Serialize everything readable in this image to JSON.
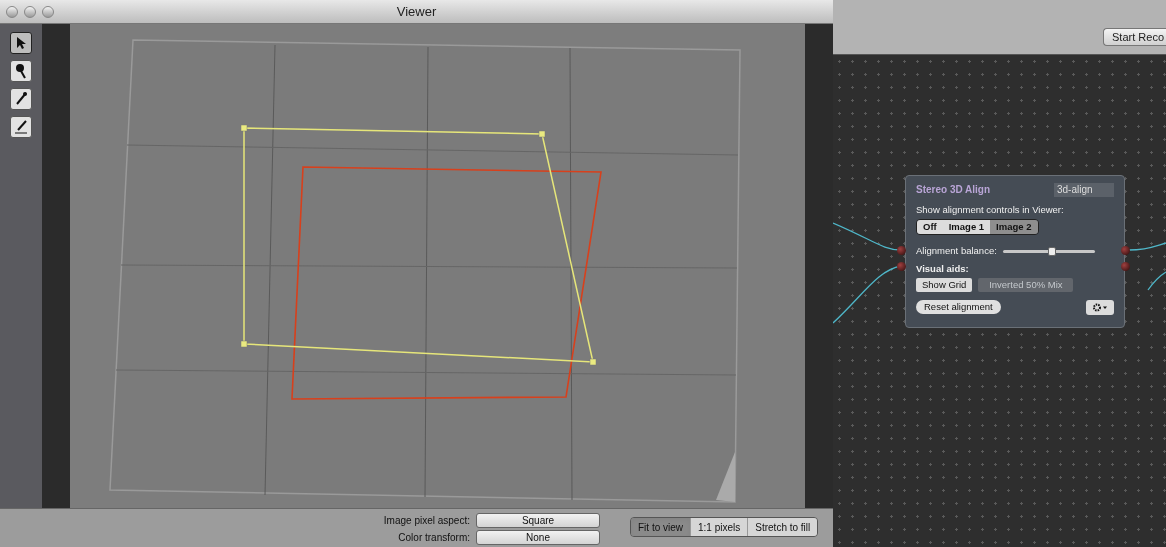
{
  "viewer": {
    "title": "Viewer",
    "tools": [
      {
        "kind": "arrow",
        "selected": true
      },
      {
        "kind": "pin",
        "selected": false
      },
      {
        "kind": "dropper",
        "selected": false
      },
      {
        "kind": "dropper-line",
        "selected": false
      }
    ]
  },
  "bottom_bar": {
    "fields": [
      {
        "label": "Image pixel aspect:",
        "value": "Square"
      },
      {
        "label": "Color transform:",
        "value": "None"
      }
    ],
    "fit_modes": [
      {
        "label": "Fit to view",
        "selected": true
      },
      {
        "label": "1:1 pixels",
        "selected": false
      },
      {
        "label": "Stretch to fill",
        "selected": false
      }
    ]
  },
  "toolbar": {
    "button": "Start Reco"
  },
  "node": {
    "title": "Stereo 3D Align",
    "name": "3d-align",
    "controls_label": "Show alignment controls in Viewer:",
    "modes": [
      {
        "label": "Off",
        "selected": false
      },
      {
        "label": "Image 1",
        "selected": false
      },
      {
        "label": "Image 2",
        "selected": true
      }
    ],
    "balance_label": "Alignment balance:",
    "balance": {
      "level": 0.53
    },
    "visual_aids_label": "Visual aids:",
    "aids": [
      {
        "label": "Show Grid",
        "disabled": false
      },
      {
        "label": "Inverted 50% Mix",
        "disabled": true
      }
    ],
    "reset_button": "Reset alignment"
  }
}
